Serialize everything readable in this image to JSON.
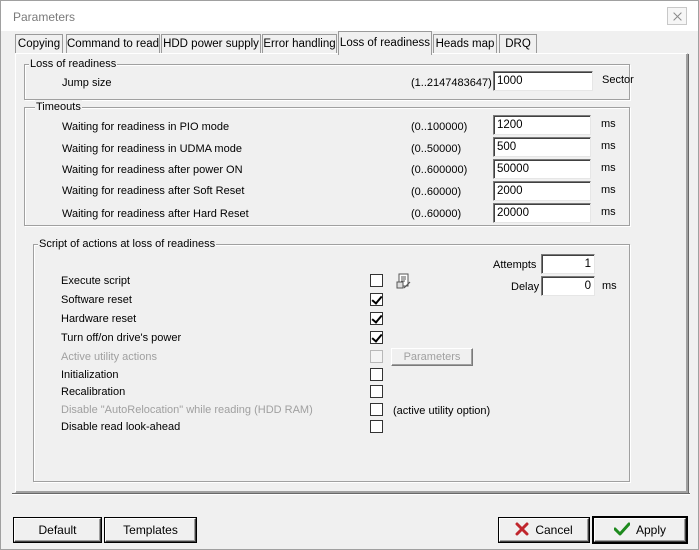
{
  "window": {
    "title": "Parameters"
  },
  "tabs": [
    {
      "label": "Copying"
    },
    {
      "label": "Command to read"
    },
    {
      "label": "HDD power supply"
    },
    {
      "label": "Error handling"
    },
    {
      "label": "Loss of readiness"
    },
    {
      "label": "Heads map"
    },
    {
      "label": "DRQ"
    }
  ],
  "loss": {
    "title": "Loss of readiness",
    "jump_label": "Jump size",
    "jump_range": "(1..2147483647)",
    "jump_value": "1000",
    "jump_unit": "Sector"
  },
  "timeouts": {
    "title": "Timeouts",
    "rows": [
      {
        "label": "Waiting for readiness in PIO mode",
        "range": "(0..100000)",
        "value": "1200",
        "unit": "ms"
      },
      {
        "label": "Waiting for readiness in UDMA mode",
        "range": "(0..50000)",
        "value": "500",
        "unit": "ms"
      },
      {
        "label": "Waiting for readiness after power ON",
        "range": "(0..600000)",
        "value": "50000",
        "unit": "ms"
      },
      {
        "label": "Waiting for readiness after Soft Reset",
        "range": "(0..60000)",
        "value": "2000",
        "unit": "ms"
      },
      {
        "label": "Waiting for readiness after Hard Reset",
        "range": "(0..60000)",
        "value": "20000",
        "unit": "ms"
      }
    ]
  },
  "script": {
    "title": "Script of actions at loss of readiness",
    "attempts_label": "Attempts",
    "attempts_value": "1",
    "delay_label": "Delay",
    "delay_value": "0",
    "delay_unit": "ms",
    "parameters_button": "Parameters",
    "active_utility_note": "(active utility option)",
    "items": [
      {
        "label": "Execute script",
        "checked": false,
        "disabled": false
      },
      {
        "label": "Software reset",
        "checked": true,
        "disabled": false
      },
      {
        "label": "Hardware reset",
        "checked": true,
        "disabled": false
      },
      {
        "label": "Turn off/on drive's power",
        "checked": true,
        "disabled": false
      },
      {
        "label": "Active utility actions",
        "checked": false,
        "disabled": true
      },
      {
        "label": "Initialization",
        "checked": false,
        "disabled": false
      },
      {
        "label": "Recalibration",
        "checked": false,
        "disabled": false
      },
      {
        "label": "Disable \"AutoRelocation\" while reading (HDD RAM)",
        "checked": false,
        "disabled": true
      },
      {
        "label": "Disable read look-ahead",
        "checked": false,
        "disabled": false
      }
    ]
  },
  "footer": {
    "default_label": "Default",
    "templates_label": "Templates",
    "cancel_label": "Cancel",
    "apply_label": "Apply"
  },
  "colors": {
    "cancel_icon": "#c0262d",
    "apply_icon": "#1e8a1e",
    "disabled_text": "#a0a0a0"
  }
}
